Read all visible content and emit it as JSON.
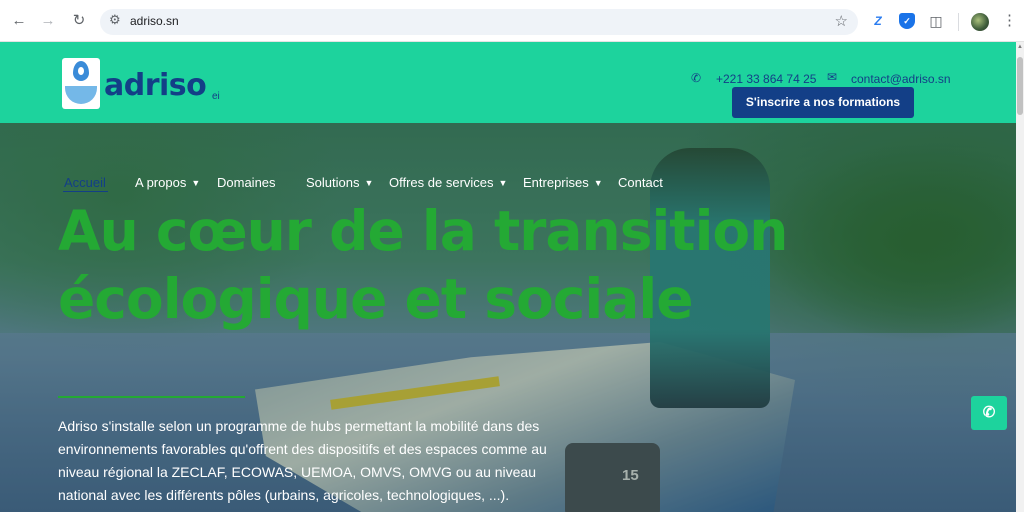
{
  "browser": {
    "url": "adriso.sn",
    "icons": {
      "back": "arrow-left-icon",
      "forward": "arrow-right-icon",
      "reload": "reload-icon",
      "site_info": "tune-icon",
      "bookmark": "star-icon",
      "extension_z": "z-extension-icon",
      "extension_shield": "shield-extension-icon",
      "extensions": "puzzle-icon",
      "profile": "avatar",
      "menu": "more-vert-icon"
    }
  },
  "header": {
    "brand": "adriso",
    "brand_suffix": "ei",
    "phone": "+221 33 864 74 25",
    "email": "contact@adriso.sn",
    "cta_label": "S'inscrire a nos formations",
    "colors": {
      "header_bg": "#1dd39d",
      "brand_blue": "#133f87"
    }
  },
  "nav": {
    "items": [
      {
        "label": "Accueil",
        "active": true,
        "dropdown": false
      },
      {
        "label": "A propos",
        "active": false,
        "dropdown": true
      },
      {
        "label": "Domaines",
        "active": false,
        "dropdown": false
      },
      {
        "label": "Solutions",
        "active": false,
        "dropdown": true
      },
      {
        "label": "Offres de services",
        "active": false,
        "dropdown": true
      },
      {
        "label": "Entreprises",
        "active": false,
        "dropdown": true
      },
      {
        "label": "Contact",
        "active": false,
        "dropdown": false
      }
    ]
  },
  "hero": {
    "title_line1": "Au cœur de la transition",
    "title_line2": "écologique et sociale",
    "motor_label": "15",
    "description": "Adriso s'installe selon un programme de hubs permettant la mobilité dans des environnements favorables qu'offrent des dispositifs et des espaces comme au niveau régional la ZECLAF, ECOWAS, UEMOA, OMVS, OMVG ou au niveau national avec les différents pôles (urbains, agricoles, technologiques, ...).",
    "colors": {
      "title_green": "#24a934"
    }
  },
  "floating": {
    "phone_icon": "phone-icon"
  }
}
